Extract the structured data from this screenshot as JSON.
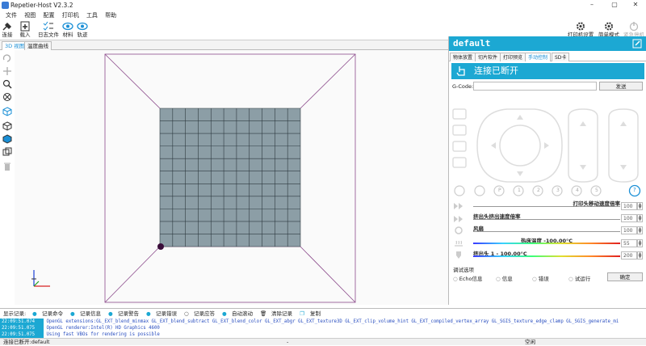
{
  "window": {
    "title": "Repetier-Host V2.3.2"
  },
  "menu": [
    "文件",
    "视图",
    "配置",
    "打印机",
    "工具",
    "帮助"
  ],
  "toolbar": {
    "connect": "连接",
    "load": "载入",
    "log": "日志文件",
    "material": "材料",
    "track": "轨迹",
    "printer_settings": "打印机设置",
    "simple_mode": "简单模式",
    "emergency": "紧急停机"
  },
  "left_tabs": [
    "3D 视图",
    "温度曲线"
  ],
  "right": {
    "profile": "default",
    "tabs": [
      "物体放置",
      "切片软件",
      "打印预览",
      "手动控制",
      "SD卡"
    ],
    "connection": "连接已断开",
    "gcode_label": "G-Code:",
    "send": "发送",
    "buttons": {
      "p": "P",
      "b1": "1",
      "b2": "2",
      "b3": "3",
      "b4": "4",
      "b5": "5",
      "help": "?"
    },
    "sliders": [
      {
        "label": "打印头移动速度倍率",
        "value": "100"
      },
      {
        "label": "挤出头挤出速度倍率",
        "value": "100"
      },
      {
        "label": "风扇",
        "value": "100"
      },
      {
        "label": "热床温度 -100.00°C",
        "value": "55"
      },
      {
        "label": "挤出头 1 - 100.00°C",
        "value": "200"
      }
    ],
    "debug_title": "调试选项",
    "debug_options": [
      "Echo信息",
      "信息",
      "错误",
      "试运行"
    ],
    "ok": "确定"
  },
  "log_toolbar": {
    "label": "显示记录:",
    "items": [
      "记录命令",
      "记录信息",
      "记录警告",
      "记录错误",
      "记录应答",
      "自动滚动",
      "清除记录",
      "复制"
    ]
  },
  "log": [
    {
      "time": "22:09:51.074",
      "text": "OpenGL extensions:GL_EXT_blend_minmax GL_EXT_blend_subtract GL_EXT_blend_color GL_EXT_abgr GL_EXT_texture3D GL_EXT_clip_volume_hint GL_EXT_compiled_vertex_array GL_SGIS_texture_edge_clamp GL_SGIS_generate_mi"
    },
    {
      "time": "22:09:51.075",
      "text": "OpenGL renderer:Intel(R) HD Graphics 4600"
    },
    {
      "time": "22:09:51.075",
      "text": "Using fast VBOs for rendering is possible"
    }
  ],
  "status": {
    "left": "连接已断开:default",
    "mid": "-",
    "right": "空闲"
  }
}
